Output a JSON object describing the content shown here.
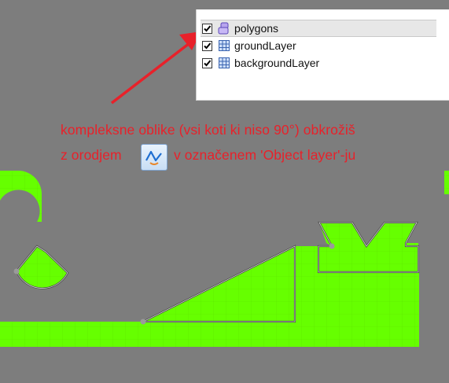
{
  "layers_panel": {
    "layers": [
      {
        "name": "polygons",
        "visible": true,
        "type_icon": "object-layer-icon",
        "selected": true
      },
      {
        "name": "groundLayer",
        "visible": true,
        "type_icon": "tile-layer-icon",
        "selected": false
      },
      {
        "name": "backgroundLayer",
        "visible": true,
        "type_icon": "tile-layer-icon",
        "selected": false
      }
    ]
  },
  "annotation": {
    "line1": "kompleksne oblike (vsi koti ki niso 90°) obkrožiš",
    "line2_before": "z orodjem",
    "line2_after": "v označenem 'Object layer'-ju",
    "tool_icon": "insert-polygon-tool-icon",
    "color": "#e8212a"
  },
  "scene": {
    "background_color": "#7d7d7d",
    "ground_color": "#66ff00",
    "polygon_outline_color": "#c8c8c8"
  }
}
